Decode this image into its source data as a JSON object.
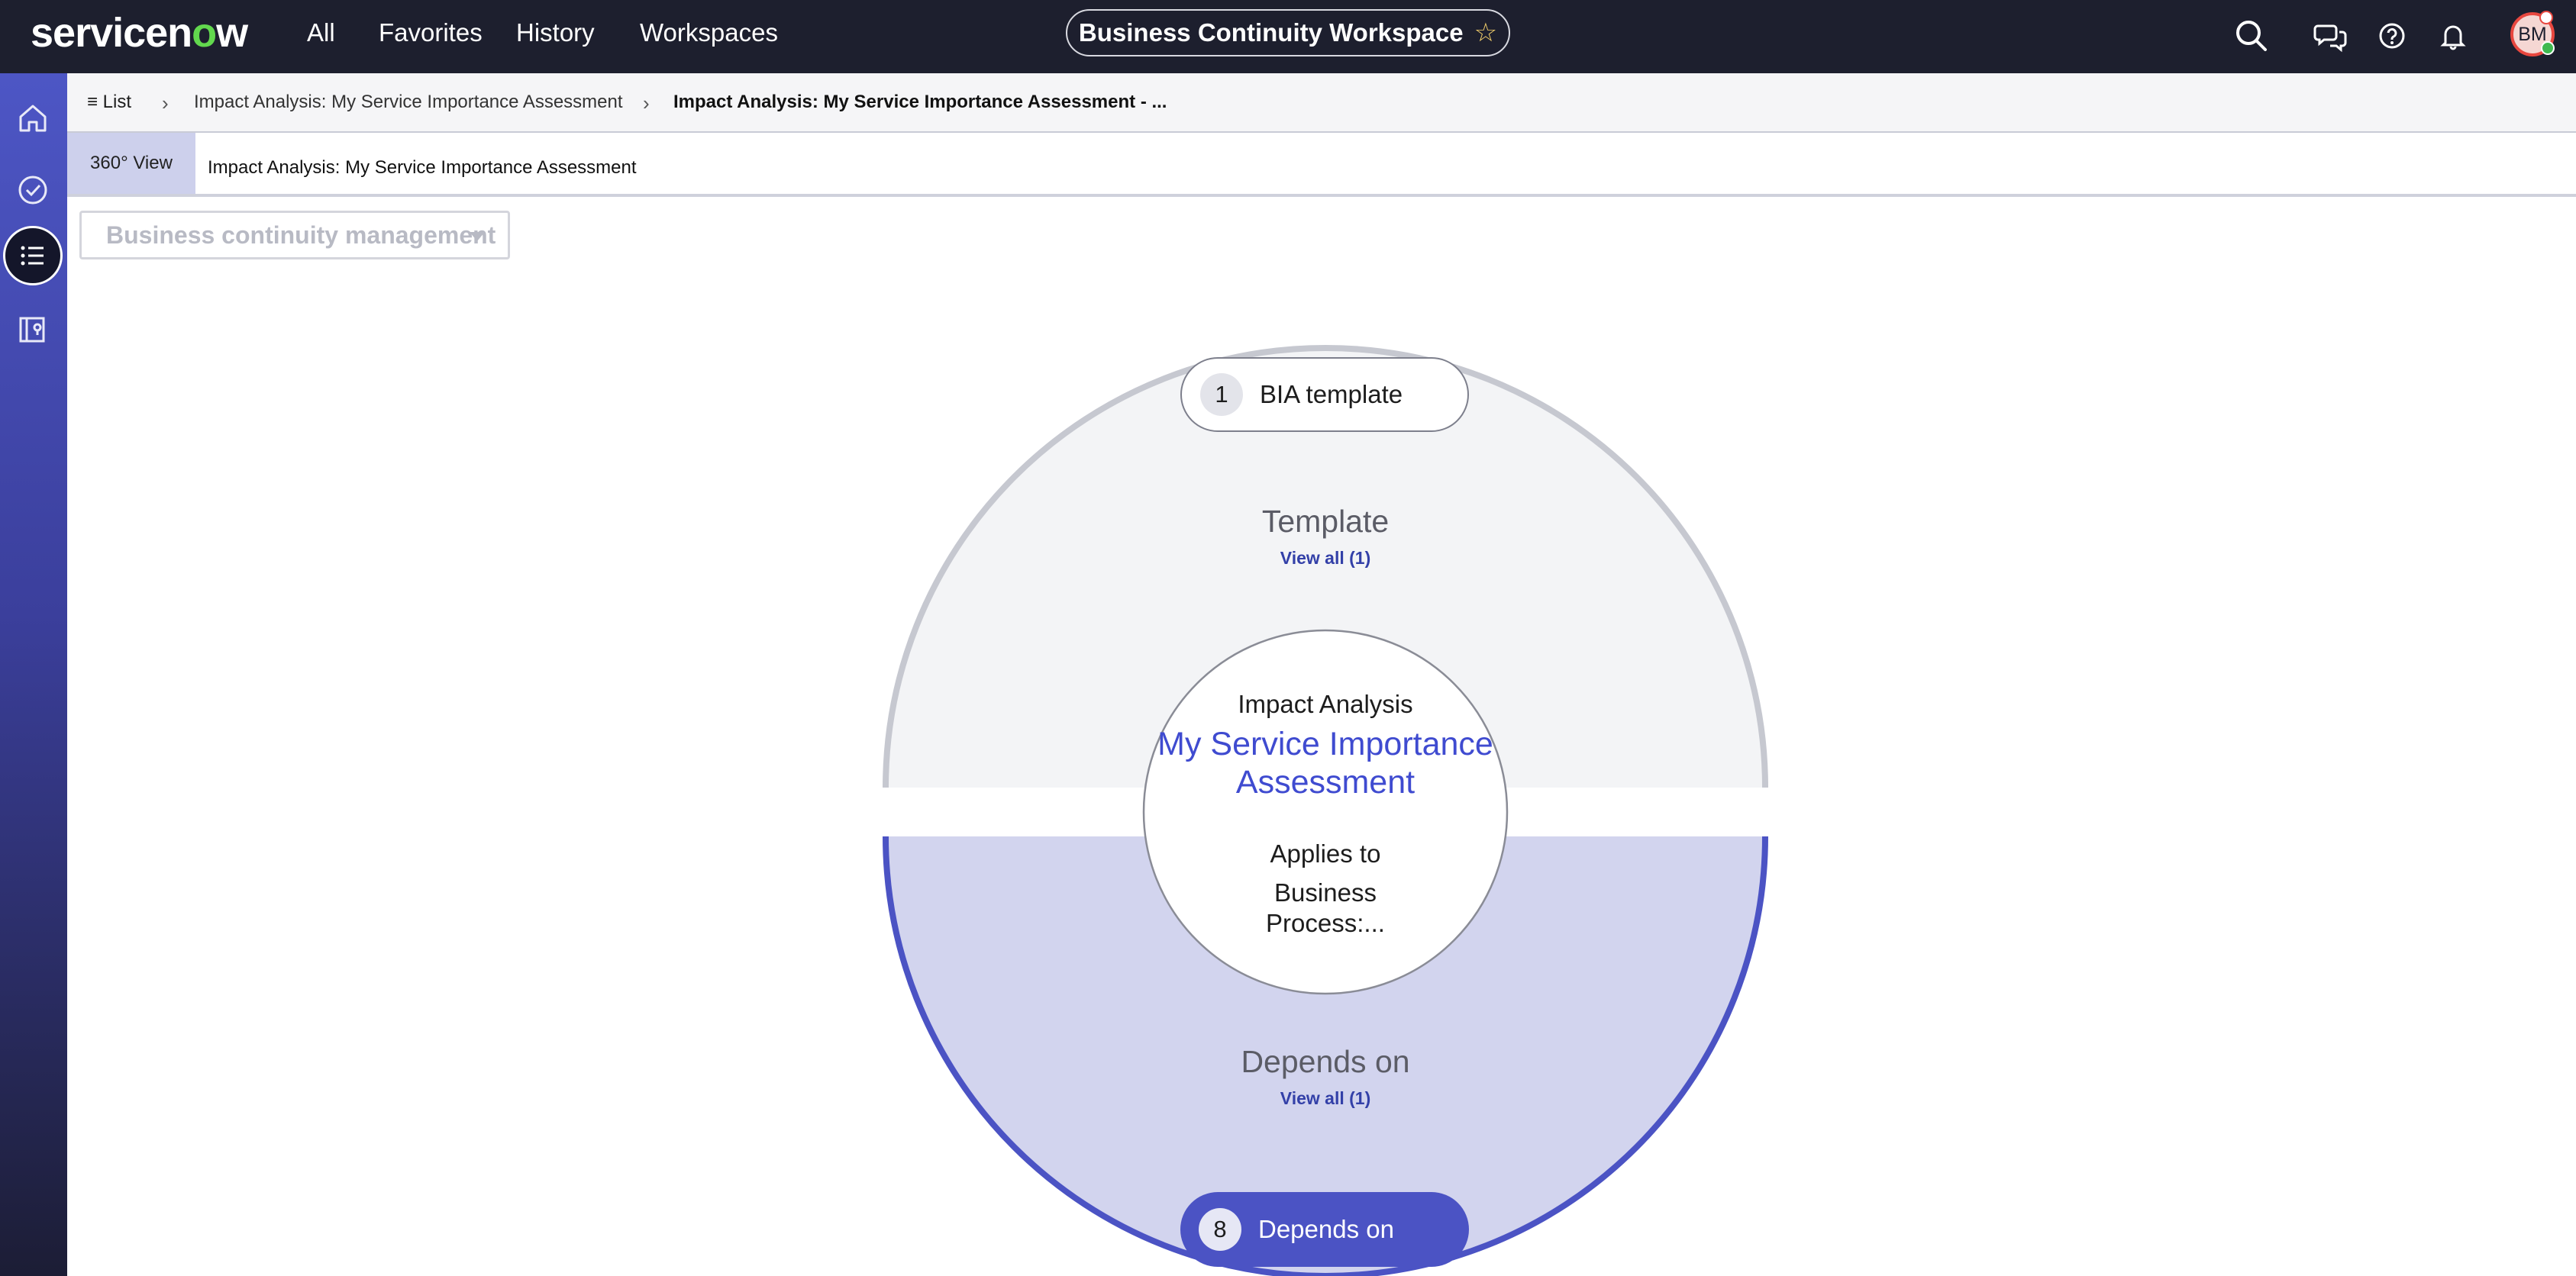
{
  "topbar": {
    "logo_prefix": "servicen",
    "logo_o": "o",
    "logo_suffix": "w",
    "nav": [
      "All",
      "Favorites",
      "History",
      "Workspaces"
    ],
    "workspace_title": "Business Continuity Workspace",
    "avatar_initials": "BM",
    "icons": [
      "search-icon",
      "chat-icon",
      "help-icon",
      "bell-icon"
    ]
  },
  "rail": {
    "icons": [
      "home-icon",
      "checkmark-circle-icon",
      "list-icon",
      "map-book-icon"
    ],
    "active": "list-icon"
  },
  "breadcrumb": {
    "list_label": "List",
    "item1": "Impact Analysis: My Service Importance Assessment",
    "item2": "Impact Analysis: My Service Importance Assessment - ..."
  },
  "tabs": {
    "view_tab": "360° View",
    "record_title": "Impact Analysis: My Service Importance Assessment"
  },
  "filter": {
    "selected": "Business continuity management"
  },
  "diagram": {
    "top_section": {
      "title": "Template",
      "link": "View all (1)"
    },
    "bottom_section": {
      "title": "Depends on",
      "link": "View all (1)"
    },
    "center": {
      "type": "Impact Analysis",
      "name": "My Service Importance Assessment",
      "applies_label": "Applies to",
      "applies_value": "Business Process:..."
    },
    "top_pill": {
      "count": "1",
      "label": "BIA template"
    },
    "bottom_pill": {
      "count": "8",
      "label": "Depends on"
    }
  },
  "colors": {
    "topbar": "#1d1f2e",
    "accent": "#4b53c4",
    "link": "#3340a8",
    "top_half_fill": "#f3f4f6",
    "bottom_half_fill": "#d2d4ee"
  }
}
